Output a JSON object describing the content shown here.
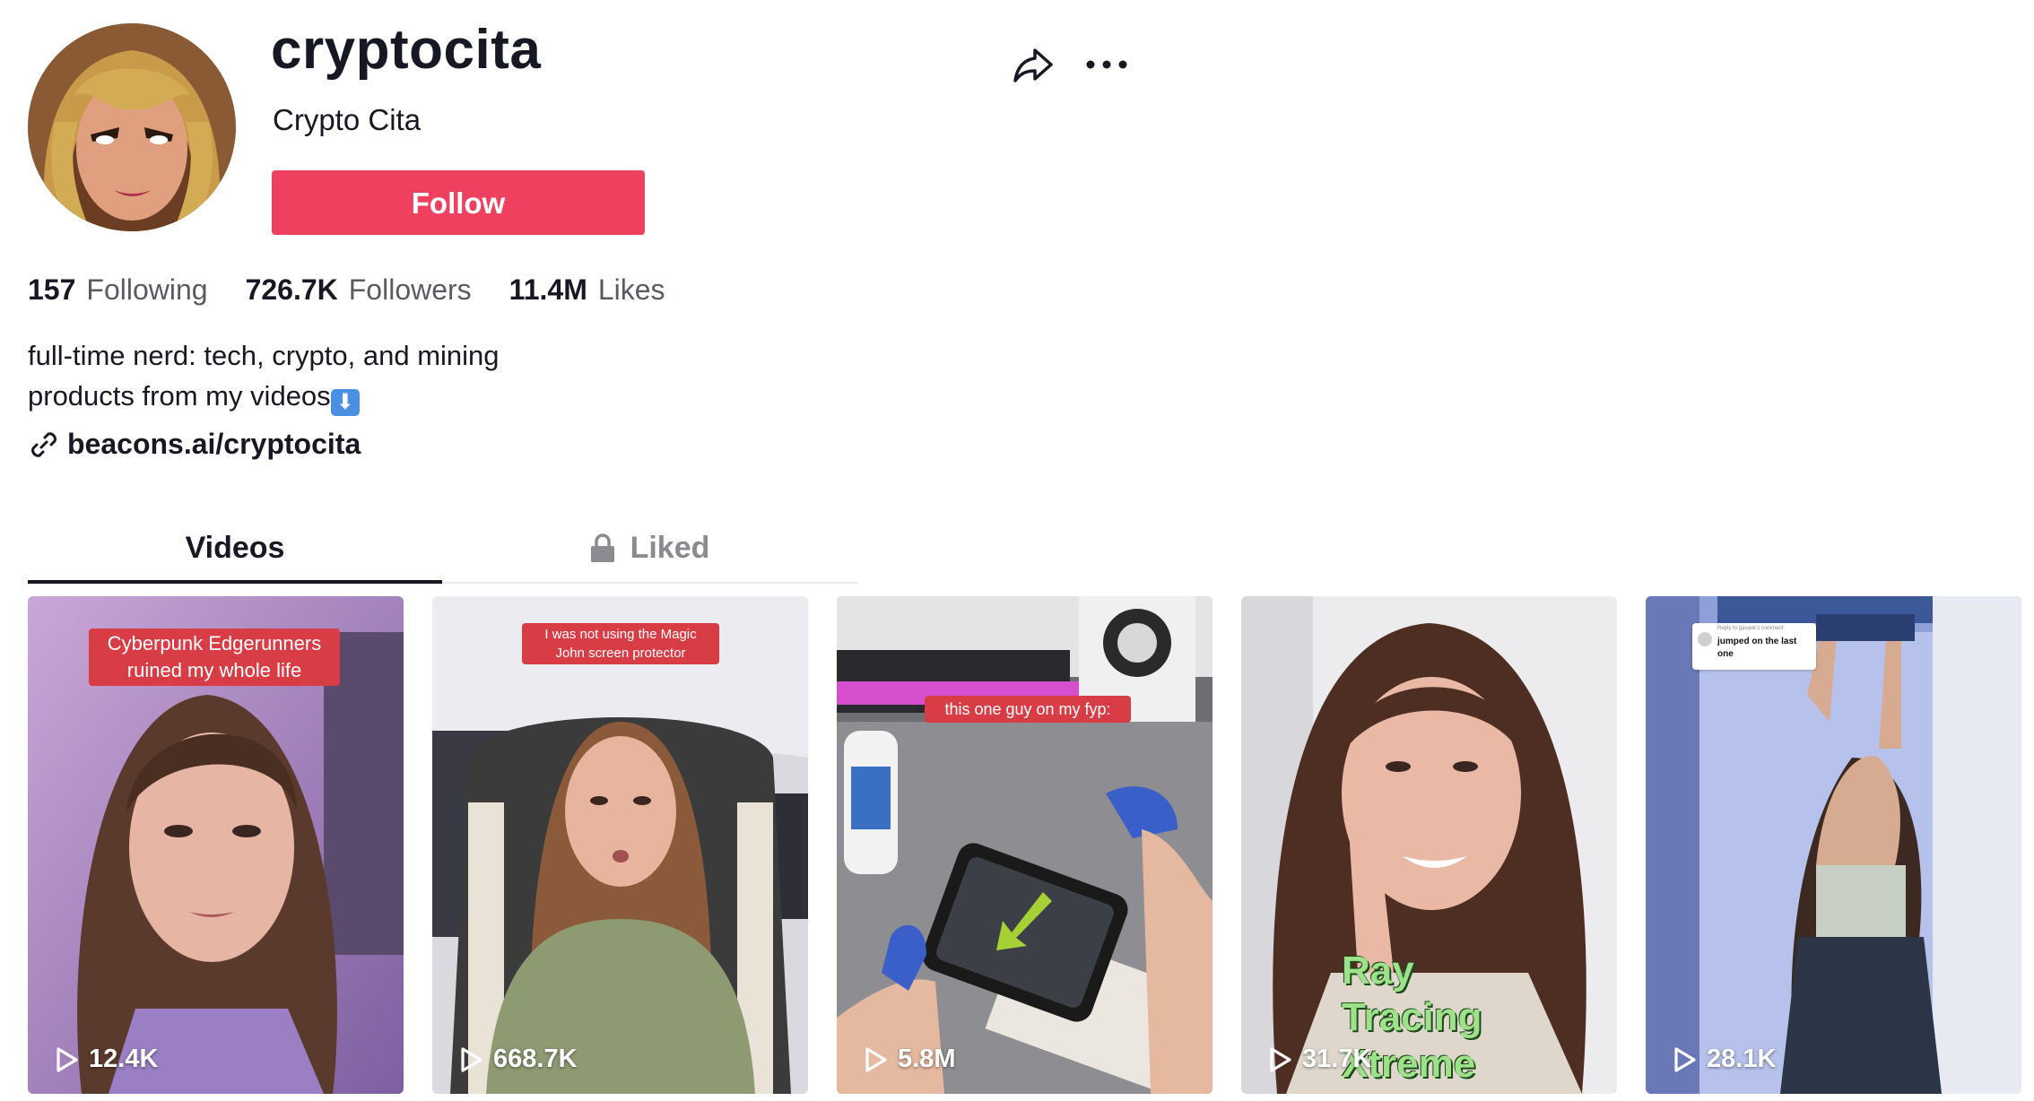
{
  "profile": {
    "username": "cryptocita",
    "display_name": "Crypto Cita",
    "follow_label": "Follow"
  },
  "actions": {
    "share_icon": "share-arrow-icon",
    "more_icon": "ellipsis-icon"
  },
  "stats": [
    {
      "value": "157",
      "label": "Following"
    },
    {
      "value": "726.7K",
      "label": "Followers"
    },
    {
      "value": "11.4M",
      "label": "Likes"
    }
  ],
  "bio": {
    "line1": "full-time nerd: tech, crypto, and mining",
    "line2": "products from my videos",
    "arrow_emoji": "⬇"
  },
  "link": {
    "icon": "link-icon",
    "text": "beacons.ai/cryptocita"
  },
  "tabs": [
    {
      "label": "Videos",
      "active": true
    },
    {
      "label": "Liked",
      "active": false,
      "icon": "lock-icon"
    }
  ],
  "videos": [
    {
      "caption": "Cyberpunk Edgerunners ruined my whole life",
      "views": "12.4K"
    },
    {
      "caption": "I was not using the Magic John screen protector",
      "views": "668.7K"
    },
    {
      "caption": "this one guy on my fyp:",
      "views": "5.8M"
    },
    {
      "overlay": [
        "Ray",
        "Tracing",
        "Xtreme"
      ],
      "views": "31.7K"
    },
    {
      "reply_header": "Reply to gávank's comment",
      "reply_text": "jumped on the last one",
      "views": "28.1K"
    }
  ],
  "colors": {
    "follow": "#ef4060",
    "text": "#161823",
    "secondary": "#5a5b62",
    "tab_inactive": "#8a8b91"
  }
}
